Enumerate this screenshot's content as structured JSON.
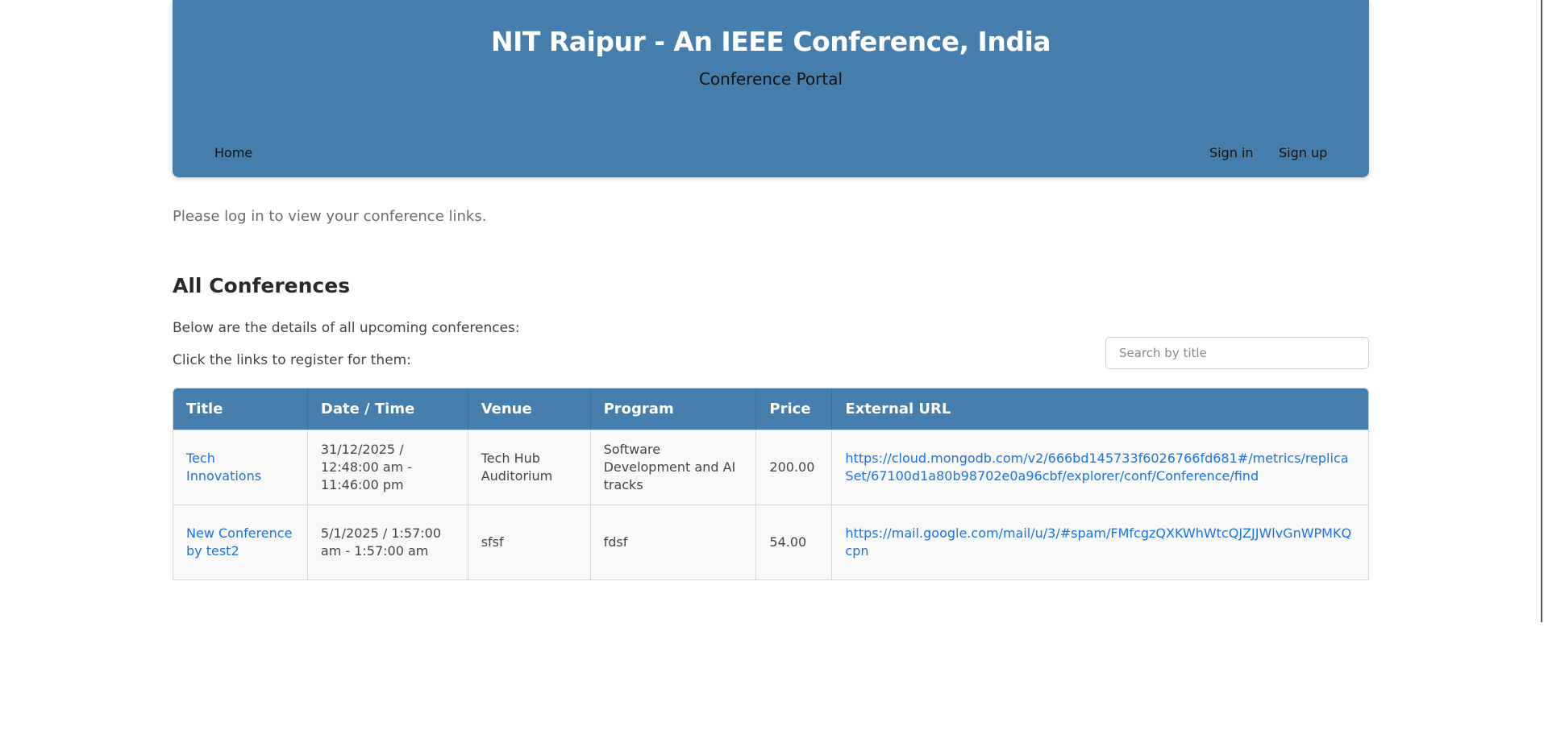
{
  "header": {
    "title": "NIT Raipur - An IEEE Conference, India",
    "subtitle": "Conference Portal",
    "nav": {
      "home": "Home",
      "sign_in": "Sign in",
      "sign_up": "Sign up"
    },
    "background_color": "#457eac"
  },
  "main": {
    "login_message": "Please log in to view your conference links.",
    "section_title": "All Conferences",
    "description_1": "Below are the details of all upcoming conferences:",
    "description_2": "Click the links to register for them:",
    "search": {
      "placeholder": "Search by title",
      "value": ""
    },
    "table": {
      "headers": [
        "Title",
        "Date / Time",
        "Venue",
        "Program",
        "Price",
        "External URL"
      ],
      "rows": [
        {
          "title": "Tech Innovations",
          "datetime": "31/12/2025 / 12:48:00 am - 11:46:00 pm",
          "venue": "Tech Hub Auditorium",
          "program": "Software Development and AI tracks",
          "price": "200.00",
          "url": "https://cloud.mongodb.com/v2/666bd145733f6026766fd681#/metrics/replicaSet/67100d1a80b98702e0a96cbf/explorer/conf/Conference/find"
        },
        {
          "title": "New Conference by test2",
          "datetime": "5/1/2025 / 1:57:00 am - 1:57:00 am",
          "venue": "sfsf",
          "program": "fdsf",
          "price": "54.00",
          "url": "https://mail.google.com/mail/u/3/#spam/FMfcgzQXKWhWtcQJZJJWlvGnWPMKQcpn"
        }
      ]
    },
    "link_color": "#1a73e8"
  }
}
